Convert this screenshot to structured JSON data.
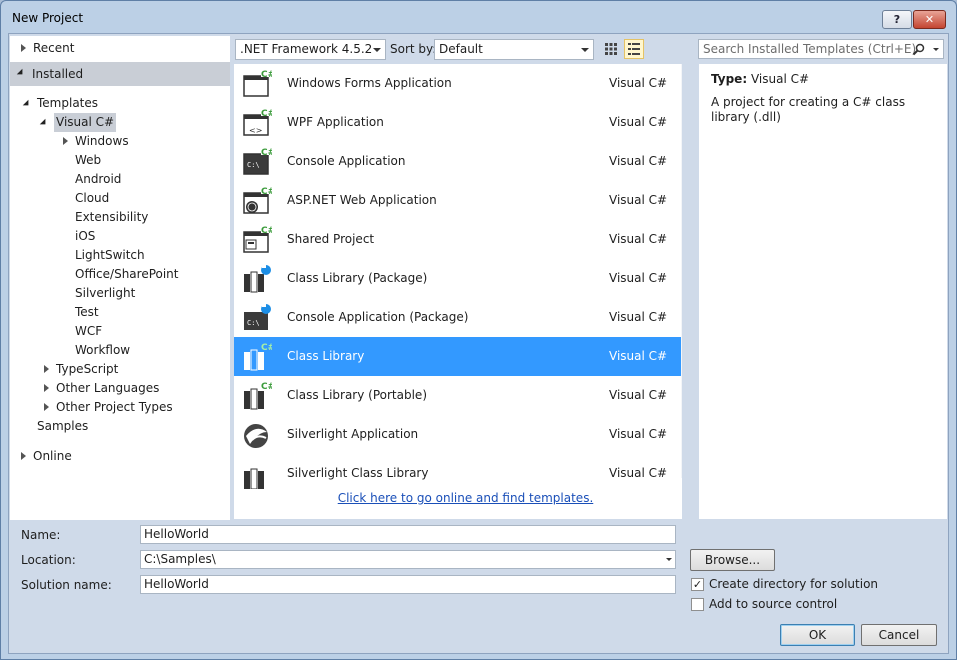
{
  "window": {
    "title": "New Project",
    "help_button": "?",
    "close_button": "✕"
  },
  "sidebar": {
    "recent": "Recent",
    "installed": "Installed",
    "templates": "Templates",
    "visual_csharp": "Visual C#",
    "children": [
      "Windows",
      "Web",
      "Android",
      "Cloud",
      "Extensibility",
      "iOS",
      "LightSwitch",
      "Office/SharePoint",
      "Silverlight",
      "Test",
      "WCF",
      "Workflow"
    ],
    "typescript": "TypeScript",
    "other_languages": "Other Languages",
    "other_project_types": "Other Project Types",
    "samples": "Samples",
    "online": "Online"
  },
  "toolbar": {
    "framework": ".NET Framework 4.5.2",
    "sort_by_label": "Sort by:",
    "sort_by_value": "Default",
    "search_placeholder": "Search Installed Templates (Ctrl+E)"
  },
  "templates": [
    {
      "name": "Windows Forms Application",
      "language": "Visual C#",
      "icon": "windows-forms-icon"
    },
    {
      "name": "WPF Application",
      "language": "Visual C#",
      "icon": "wpf-icon"
    },
    {
      "name": "Console Application",
      "language": "Visual C#",
      "icon": "console-icon"
    },
    {
      "name": "ASP.NET Web Application",
      "language": "Visual C#",
      "icon": "web-icon"
    },
    {
      "name": "Shared Project",
      "language": "Visual C#",
      "icon": "shared-project-icon"
    },
    {
      "name": "Class Library (Package)",
      "language": "Visual C#",
      "icon": "class-library-package-icon"
    },
    {
      "name": "Console Application (Package)",
      "language": "Visual C#",
      "icon": "console-package-icon"
    },
    {
      "name": "Class Library",
      "language": "Visual C#",
      "icon": "class-library-icon"
    },
    {
      "name": "Class Library (Portable)",
      "language": "Visual C#",
      "icon": "class-library-portable-icon"
    },
    {
      "name": "Silverlight Application",
      "language": "Visual C#",
      "icon": "silverlight-icon"
    },
    {
      "name": "Silverlight Class Library",
      "language": "Visual C#",
      "icon": "silverlight-library-icon"
    }
  ],
  "online_link": "Click here to go online and find templates.",
  "details": {
    "type_label": "Type:",
    "type_value": "Visual C#",
    "description": "A project for creating a C# class library (.dll)"
  },
  "form": {
    "name_label": "Name:",
    "name_value": "HelloWorld",
    "location_label": "Location:",
    "location_value": "C:\\Samples\\",
    "solution_label": "Solution name:",
    "solution_value": "HelloWorld",
    "browse": "Browse...",
    "create_directory": "Create directory for solution",
    "create_directory_checked": true,
    "source_control": "Add to source control",
    "source_control_checked": false,
    "ok": "OK",
    "cancel": "Cancel"
  }
}
